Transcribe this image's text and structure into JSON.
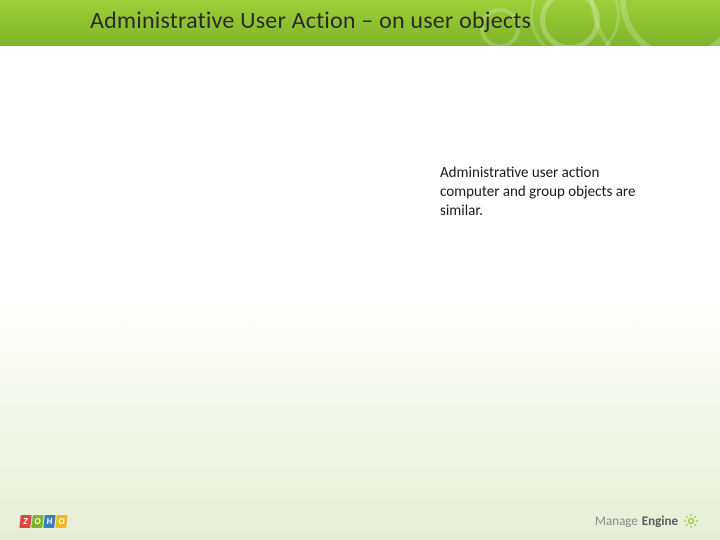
{
  "header": {
    "title": "Administrative User Action – on user objects"
  },
  "body": {
    "note": "Administrative user action computer and group objects are similar."
  },
  "footer": {
    "zoho_letters": [
      "Z",
      "O",
      "H",
      "O"
    ],
    "manageengine_prefix": "Manage",
    "manageengine_suffix": "Engine"
  },
  "colors": {
    "accent_green": "#8bbf2f",
    "text_dark": "#2b2b2b"
  }
}
